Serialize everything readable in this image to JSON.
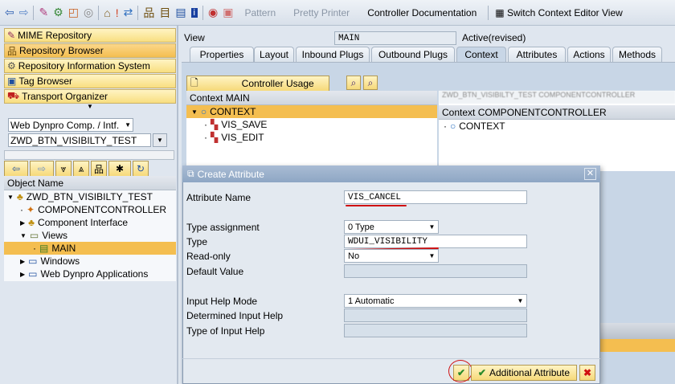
{
  "toolbar": {
    "pattern": "Pattern",
    "pretty_printer": "Pretty Printer",
    "controller_doc": "Controller Documentation",
    "switch_editor": "Switch Context Editor View"
  },
  "nav": {
    "mime": "MIME Repository",
    "repo_browser": "Repository Browser",
    "repo_info": "Repository Information System",
    "tag": "Tag Browser",
    "transport": "Transport Organizer"
  },
  "object_type": "Web Dynpro Comp. / Intf.",
  "object_name": "ZWD_BTN_VISIBILTY_TEST",
  "tree": {
    "header": "Object Name",
    "root": "ZWD_BTN_VISIBILTY_TEST",
    "items": [
      "COMPONENTCONTROLLER",
      "Component Interface",
      "Views",
      "MAIN",
      "Windows",
      "Web Dynpro Applications"
    ]
  },
  "view": {
    "label": "View",
    "name": "MAIN",
    "status": "Active(revised)"
  },
  "tabs": [
    "Properties",
    "Layout",
    "Inbound Plugs",
    "Outbound Plugs",
    "Context",
    "Attributes",
    "Actions",
    "Methods"
  ],
  "context": {
    "controller_usage": "Controller Usage",
    "main_header": "Context MAIN",
    "root": "CONTEXT",
    "nodes": [
      "VIS_SAVE",
      "VIS_EDIT"
    ],
    "cc_header": "Context COMPONENTCONTROLLER",
    "cc_root": "CONTEXT",
    "cc_title": "ZWD_BTN_VISIBILTY_TEST COMPONENTCONTROLLER"
  },
  "dialog": {
    "title": "Create Attribute",
    "attribute_name_label": "Attribute Name",
    "attribute_name": "VIS_CANCEL",
    "type_assignment_label": "Type assignment",
    "type_assignment": "0 Type",
    "type_label": "Type",
    "type": "WDUI_VISIBILITY",
    "read_only_label": "Read-only",
    "read_only": "No",
    "default_value_label": "Default Value",
    "input_help_mode_label": "Input Help Mode",
    "input_help_mode": "1 Automatic",
    "determined_help_label": "Determined Input Help",
    "type_help_label": "Type of Input Help",
    "additional_attribute": "Additional Attribute"
  },
  "colors": {
    "annotation": "#d01010",
    "selection": "#f4be50"
  }
}
